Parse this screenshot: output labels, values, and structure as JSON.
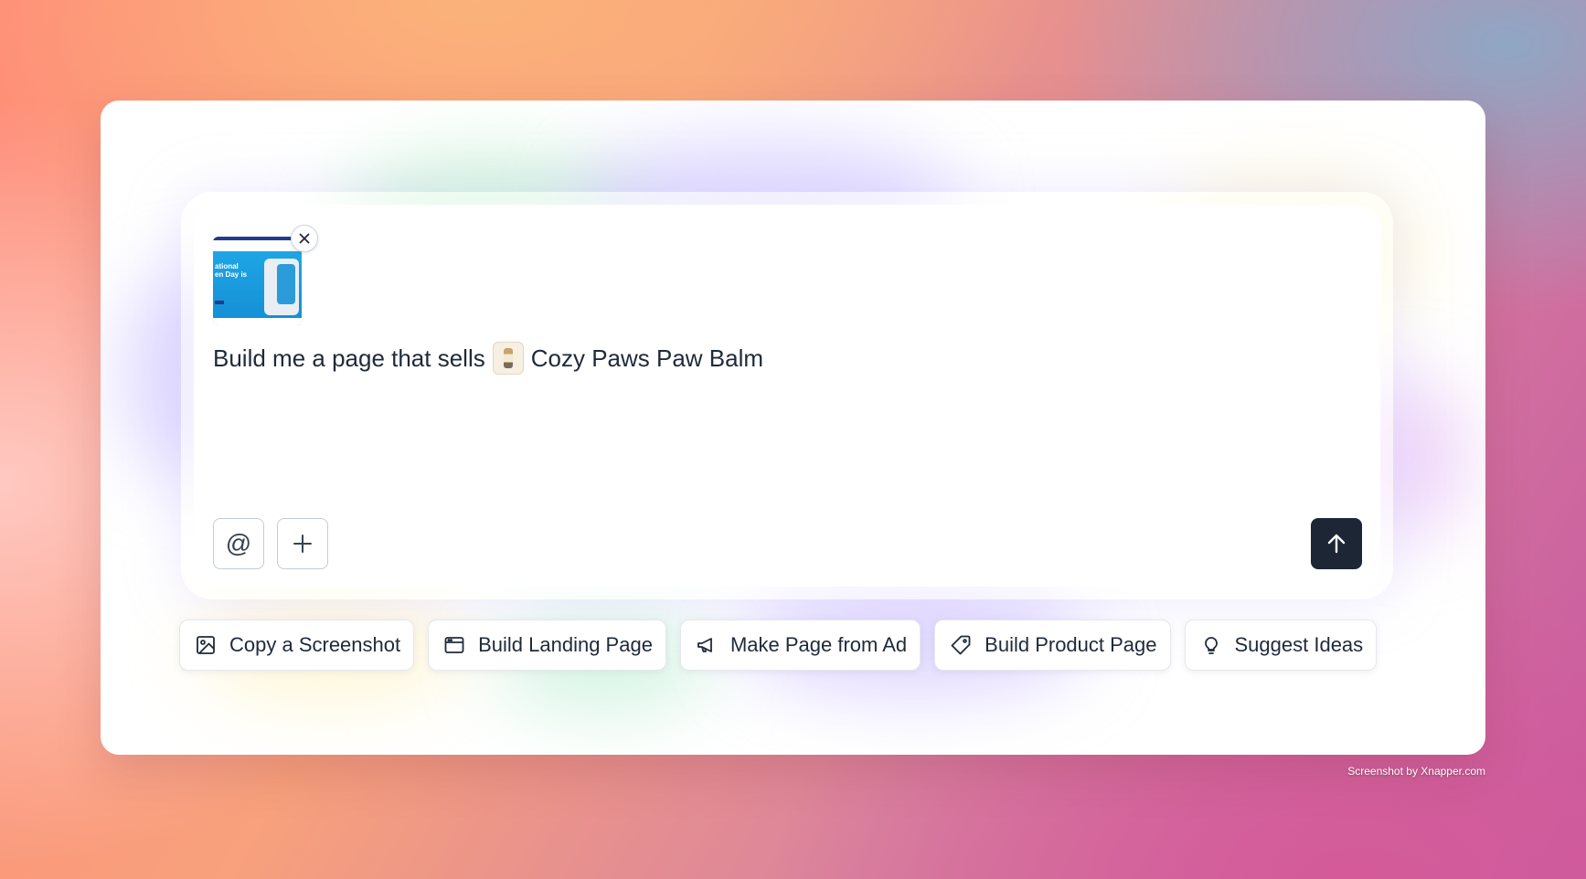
{
  "composer": {
    "prompt_text": "Build me a page that sells",
    "product_chip": "Cozy Paws Paw Balm",
    "attachment": {
      "thumbnail_text": "ational\nen Day is",
      "remove_icon": "close-icon"
    },
    "mention_icon": "@",
    "add_icon": "+",
    "send_icon": "arrow-up-icon"
  },
  "suggestions": [
    {
      "label": "Copy a Screenshot",
      "icon": "image-icon"
    },
    {
      "label": "Build Landing Page",
      "icon": "browser-window-icon"
    },
    {
      "label": "Make Page from Ad",
      "icon": "megaphone-icon"
    },
    {
      "label": "Build Product Page",
      "icon": "tag-icon"
    },
    {
      "label": "Suggest Ideas",
      "icon": "lightbulb-icon"
    }
  ],
  "watermark": "Screenshot by Xnapper.com",
  "colors": {
    "send_button": "#1c2635",
    "text": "#1f2a3a"
  }
}
